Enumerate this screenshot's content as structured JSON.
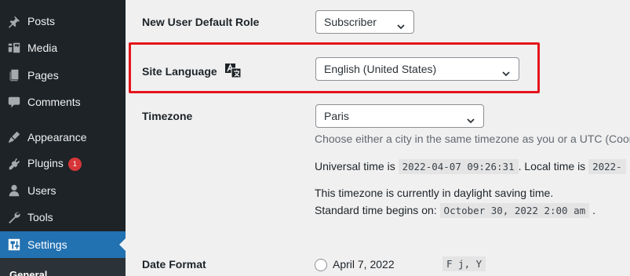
{
  "sidebar": {
    "items": [
      {
        "label": "Posts",
        "icon": "pin-icon"
      },
      {
        "label": "Media",
        "icon": "media-icon"
      },
      {
        "label": "Pages",
        "icon": "pages-icon"
      },
      {
        "label": "Comments",
        "icon": "comments-icon"
      },
      {
        "label": "Appearance",
        "icon": "brush-icon"
      },
      {
        "label": "Plugins",
        "icon": "plugin-icon",
        "badge": "1"
      },
      {
        "label": "Users",
        "icon": "users-icon"
      },
      {
        "label": "Tools",
        "icon": "wrench-icon"
      },
      {
        "label": "Settings",
        "icon": "settings-icon",
        "current": true
      }
    ],
    "submenu": {
      "current": "General"
    }
  },
  "settings": {
    "default_role": {
      "label": "New User Default Role",
      "value": "Subscriber"
    },
    "site_language": {
      "label": "Site Language",
      "value": "English (United States)"
    },
    "timezone": {
      "label": "Timezone",
      "value": "Paris",
      "description": "Choose either a city in the same timezone as you or a UTC (Coor",
      "universal_prefix": "Universal time is",
      "universal_time": "2022-04-07 09:26:31",
      "local_prefix": ". Local time is",
      "local_time": "2022-",
      "dst_note": "This timezone is currently in daylight saving time.",
      "standard_prefix": "Standard time begins on:",
      "standard_time": "October 30, 2022 2:00 am",
      "standard_suffix": "."
    },
    "date_format": {
      "label": "Date Format",
      "option_label": "April 7, 2022",
      "option_code": "F j, Y"
    }
  },
  "colors": {
    "sidebar_bg": "#1d2327",
    "accent": "#2271b1",
    "highlight": "#e5141b",
    "badge": "#d63638"
  }
}
